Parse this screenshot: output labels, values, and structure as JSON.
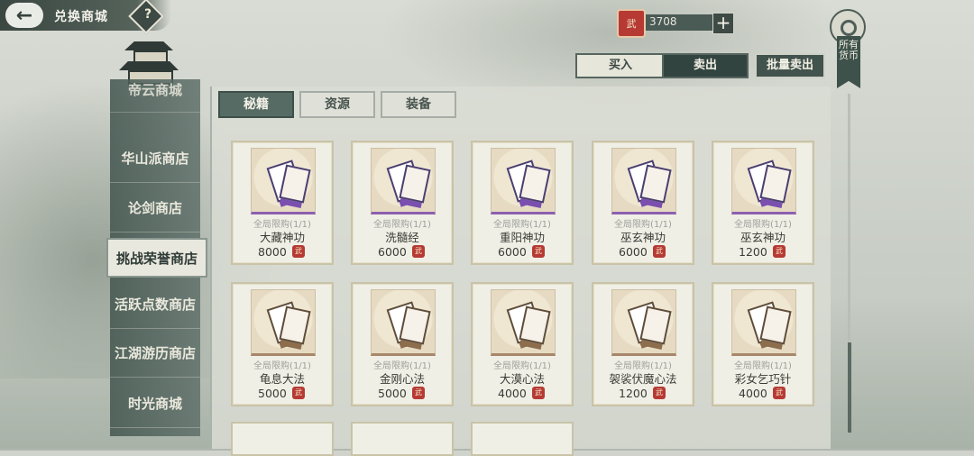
{
  "header": {
    "title": "兑换商城",
    "help": "?"
  },
  "currency": {
    "value": "3708",
    "icon_text": "武",
    "add": "+"
  },
  "trade_tabs": {
    "buy": "买入",
    "sell": "卖出",
    "batch_sell": "批量卖出"
  },
  "all_currency_label": "所有货币",
  "sidebar": {
    "items": [
      {
        "label": "帝云商城"
      },
      {
        "label": "华山派商店"
      },
      {
        "label": "论剑商店"
      },
      {
        "label": "挑战荣誉商店",
        "active": true
      },
      {
        "label": "活跃点数商店"
      },
      {
        "label": "江湖游历商店"
      },
      {
        "label": "时光商城"
      }
    ]
  },
  "subtabs": [
    "秘籍",
    "资源",
    "装备"
  ],
  "items": [
    {
      "limit": "全局限购(1/1)",
      "name": "大藏神功",
      "price": "8000",
      "rarity": "purple"
    },
    {
      "limit": "全局限购(1/1)",
      "name": "洗髓经",
      "price": "6000",
      "rarity": "purple"
    },
    {
      "limit": "全局限购(1/1)",
      "name": "重阳神功",
      "price": "6000",
      "rarity": "purple"
    },
    {
      "limit": "全局限购(1/1)",
      "name": "巫玄神功",
      "price": "6000",
      "rarity": "purple"
    },
    {
      "limit": "全局限购(1/1)",
      "name": "巫玄神功",
      "price": "1200",
      "rarity": "purple"
    },
    {
      "limit": "全局限购(1/1)",
      "name": "龟息大法",
      "price": "5000",
      "rarity": "brown"
    },
    {
      "limit": "全局限购(1/1)",
      "name": "金刚心法",
      "price": "5000",
      "rarity": "brown"
    },
    {
      "limit": "全局限购(1/1)",
      "name": "大漠心法",
      "price": "4000",
      "rarity": "brown"
    },
    {
      "limit": "全局限购(1/1)",
      "name": "袈裟伏魔心法",
      "price": "1200",
      "rarity": "brown"
    },
    {
      "limit": "全局限购(1/1)",
      "name": "彩女乞巧针",
      "price": "4000",
      "rarity": "brown"
    }
  ],
  "colors": {
    "accent": "#566b63",
    "price_icon": "#b63a33"
  }
}
